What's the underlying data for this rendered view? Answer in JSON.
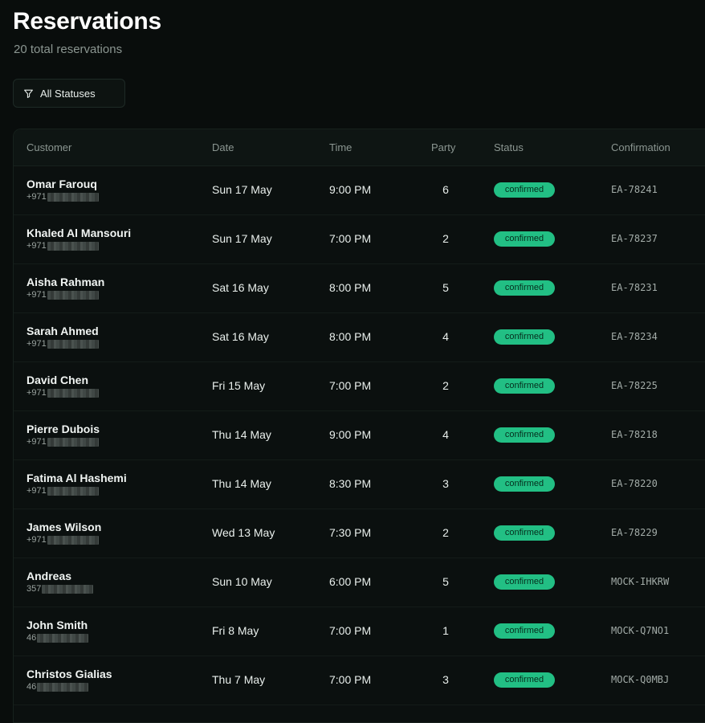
{
  "header": {
    "title": "Reservations",
    "subtitle": "20 total reservations"
  },
  "filter": {
    "label": "All Statuses",
    "icon": "filter-icon"
  },
  "table": {
    "columns": [
      "Customer",
      "Date",
      "Time",
      "Party",
      "Status",
      "Confirmation"
    ],
    "rows": [
      {
        "name": "Omar Farouq",
        "phone_prefix": "+971",
        "date": "Sun 17 May",
        "time": "9:00 PM",
        "party": "6",
        "status": "confirmed",
        "confirmation": "EA-78241"
      },
      {
        "name": "Khaled Al Mansouri",
        "phone_prefix": "+971",
        "date": "Sun 17 May",
        "time": "7:00 PM",
        "party": "2",
        "status": "confirmed",
        "confirmation": "EA-78237"
      },
      {
        "name": "Aisha Rahman",
        "phone_prefix": "+971",
        "date": "Sat 16 May",
        "time": "8:00 PM",
        "party": "5",
        "status": "confirmed",
        "confirmation": "EA-78231"
      },
      {
        "name": "Sarah Ahmed",
        "phone_prefix": "+971",
        "date": "Sat 16 May",
        "time": "8:00 PM",
        "party": "4",
        "status": "confirmed",
        "confirmation": "EA-78234"
      },
      {
        "name": "David Chen",
        "phone_prefix": "+971",
        "date": "Fri 15 May",
        "time": "7:00 PM",
        "party": "2",
        "status": "confirmed",
        "confirmation": "EA-78225"
      },
      {
        "name": "Pierre Dubois",
        "phone_prefix": "+971",
        "date": "Thu 14 May",
        "time": "9:00 PM",
        "party": "4",
        "status": "confirmed",
        "confirmation": "EA-78218"
      },
      {
        "name": "Fatima Al Hashemi",
        "phone_prefix": "+971",
        "date": "Thu 14 May",
        "time": "8:30 PM",
        "party": "3",
        "status": "confirmed",
        "confirmation": "EA-78220"
      },
      {
        "name": "James Wilson",
        "phone_prefix": "+971",
        "date": "Wed 13 May",
        "time": "7:30 PM",
        "party": "2",
        "status": "confirmed",
        "confirmation": "EA-78229"
      },
      {
        "name": "Andreas",
        "phone_prefix": "357",
        "date": "Sun 10 May",
        "time": "6:00 PM",
        "party": "5",
        "status": "confirmed",
        "confirmation": "MOCK-IHKRW"
      },
      {
        "name": "John Smith",
        "phone_prefix": "46",
        "date": "Fri 8 May",
        "time": "7:00 PM",
        "party": "1",
        "status": "confirmed",
        "confirmation": "MOCK-Q7NO1"
      },
      {
        "name": "Christos Gialias",
        "phone_prefix": "46",
        "date": "Thu 7 May",
        "time": "7:00 PM",
        "party": "3",
        "status": "confirmed",
        "confirmation": "MOCK-Q0MBJ"
      }
    ]
  },
  "colors": {
    "background": "#090d0c",
    "badge": "#22bf84",
    "muted_text": "#8b9691"
  }
}
